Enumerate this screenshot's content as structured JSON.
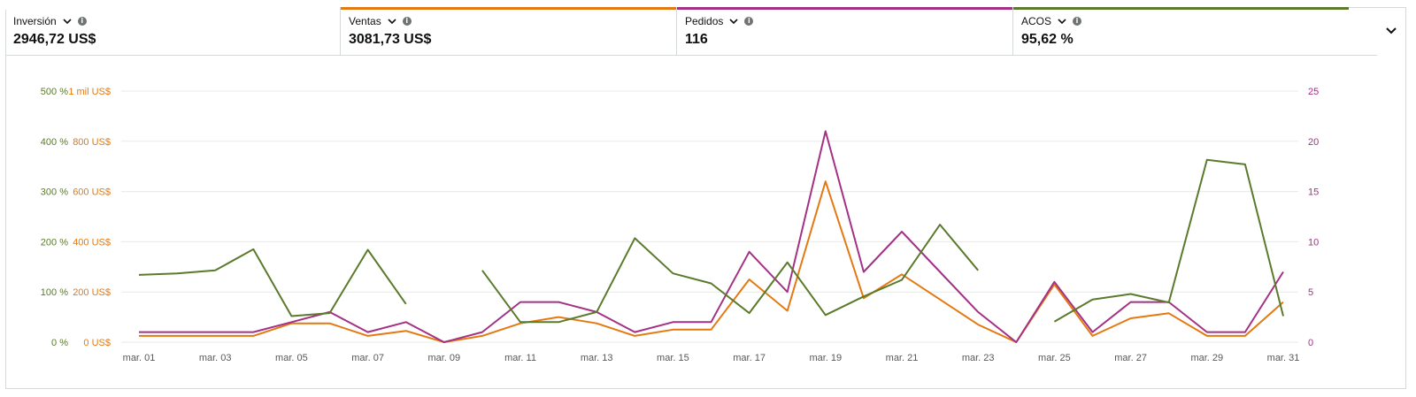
{
  "metrics": [
    {
      "label": "Inversión",
      "value": "2946,72 US$",
      "color": "#ffffff"
    },
    {
      "label": "Ventas",
      "value": "3081,73 US$",
      "color": "#e47911"
    },
    {
      "label": "Pedidos",
      "value": "116",
      "color": "#a33185"
    },
    {
      "label": "ACOS",
      "value": "95,62 %",
      "color": "#5b7a2b"
    }
  ],
  "icons": {
    "dropdown": "chevron-down-icon",
    "info": "info-icon",
    "collapse": "chevron-down-icon"
  },
  "chart_data": {
    "type": "line",
    "x": [
      "mar. 01",
      "mar. 02",
      "mar. 03",
      "mar. 04",
      "mar. 05",
      "mar. 06",
      "mar. 07",
      "mar. 08",
      "mar. 09",
      "mar. 10",
      "mar. 11",
      "mar. 12",
      "mar. 13",
      "mar. 14",
      "mar. 15",
      "mar. 16",
      "mar. 17",
      "mar. 18",
      "mar. 19",
      "mar. 20",
      "mar. 21",
      "mar. 22",
      "mar. 23",
      "mar. 24",
      "mar. 25",
      "mar. 26",
      "mar. 27",
      "mar. 28",
      "mar. 29",
      "mar. 30",
      "mar. 31"
    ],
    "x_ticks": [
      "mar. 01",
      "mar. 03",
      "mar. 05",
      "mar. 07",
      "mar. 09",
      "mar. 11",
      "mar. 13",
      "mar. 15",
      "mar. 17",
      "mar. 19",
      "mar. 21",
      "mar. 23",
      "mar. 25",
      "mar. 27",
      "mar. 29",
      "mar. 31"
    ],
    "axes": {
      "acos": {
        "ticks": [
          "0 %",
          "100 %",
          "200 %",
          "300 %",
          "400 %",
          "500 %"
        ],
        "ylim": [
          0,
          500
        ],
        "color": "#5b7a2b"
      },
      "sales": {
        "ticks": [
          "0 US$",
          "200 US$",
          "400 US$",
          "600 US$",
          "800 US$",
          "1 mil US$"
        ],
        "ylim": [
          0,
          1000
        ],
        "color": "#e47911"
      },
      "orders": {
        "ticks": [
          "0",
          "5",
          "10",
          "15",
          "20",
          "25"
        ],
        "ylim": [
          0,
          25
        ],
        "color": "#a33185"
      }
    },
    "grid": true,
    "series": [
      {
        "name": "Ventas",
        "axis": "sales",
        "color": "#e47911",
        "values": [
          25,
          25,
          25,
          25,
          75,
          75,
          25,
          45,
          0,
          25,
          75,
          100,
          75,
          25,
          50,
          50,
          250,
          125,
          640,
          175,
          270,
          170,
          70,
          0,
          230,
          25,
          95,
          115,
          25,
          25,
          160
        ]
      },
      {
        "name": "Pedidos",
        "axis": "orders",
        "color": "#a33185",
        "values": [
          1,
          1,
          1,
          1,
          2,
          3,
          1,
          2,
          0,
          1,
          4,
          4,
          3,
          1,
          2,
          2,
          9,
          5,
          21,
          7,
          11,
          7,
          3,
          0,
          6,
          1,
          4,
          4,
          1,
          1,
          7
        ]
      },
      {
        "name": "ACOS",
        "axis": "acos",
        "color": "#5b7a2b",
        "values": [
          134,
          137,
          143,
          185,
          52,
          58,
          184,
          76,
          null,
          143,
          40,
          40,
          60,
          207,
          137,
          117,
          58,
          159,
          54,
          91,
          124,
          234,
          143,
          null,
          41,
          85,
          96,
          79,
          363,
          354,
          52
        ]
      }
    ]
  }
}
